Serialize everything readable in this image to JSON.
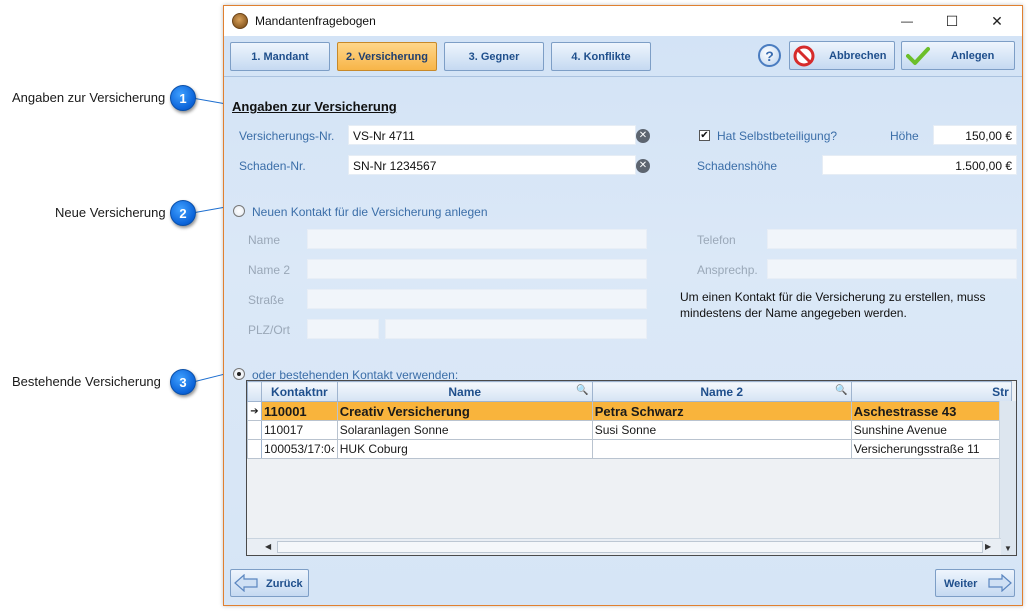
{
  "callouts": [
    {
      "number": "1",
      "label": "Angaben zur Versicherung"
    },
    {
      "number": "2",
      "label": "Neue Versicherung"
    },
    {
      "number": "3",
      "label": "Bestehende Versicherung"
    }
  ],
  "window": {
    "title": "Mandantenfragebogen",
    "minimize": "—",
    "maximize": "☐",
    "close": "✕"
  },
  "tabs": [
    {
      "label": "1. Mandant"
    },
    {
      "label": "2. Versicherung"
    },
    {
      "label": "3. Gegner"
    },
    {
      "label": "4. Konflikte"
    }
  ],
  "toolbar": {
    "help": "?",
    "cancel_label": "Abbrechen",
    "create_label": "Anlegen"
  },
  "insurance": {
    "section_title": "Angaben zur Versicherung",
    "policy_label": "Versicherungs-Nr.",
    "policy_value": "VS-Nr 4711",
    "claim_label": "Schaden-Nr.",
    "claim_value": "SN-Nr 1234567",
    "deductible_label": "Hat Selbstbeteiligung?",
    "deductible_checked": "✔",
    "amount_label": "Höhe",
    "amount_value": "150,00 €",
    "damage_label": "Schadenshöhe",
    "damage_value": "1.500,00 €"
  },
  "new_contact": {
    "radio_label": "Neuen Kontakt für die Versicherung anlegen",
    "name_label": "Name",
    "name2_label": "Name 2",
    "street_label": "Straße",
    "zip_label": "PLZ/Ort",
    "phone_label": "Telefon",
    "contact_label": "Ansprechp.",
    "hint": "Um einen Kontakt für die Versicherung zu erstellen, muss mindestens der Name angegeben werden."
  },
  "existing_contact": {
    "radio_label": "oder bestehenden Kontakt verwenden:",
    "columns": [
      "Kontaktnr",
      "Name",
      "Name 2",
      "Straße"
    ],
    "header_visible": [
      "Kontaktnr",
      "Name",
      "Name 2",
      "Str"
    ],
    "rows": [
      {
        "nr": "110001",
        "name": "Creativ Versicherung",
        "name2": "Petra Schwarz",
        "street": "Aschestrasse 43"
      },
      {
        "nr": "110017",
        "name": "Solaranlagen Sonne",
        "name2": "Susi Sonne",
        "street": "Sunshine Avenue"
      },
      {
        "nr": "100053/17:0‹",
        "name": "HUK Coburg",
        "name2": "",
        "street": "Versicherungsstraße 11"
      }
    ]
  },
  "navigation": {
    "back_label": "Zurück",
    "next_label": "Weiter"
  },
  "colors": {
    "accent": "#f7b548",
    "badge": "#0a62d8",
    "label_blue": "#3b6ea8"
  }
}
